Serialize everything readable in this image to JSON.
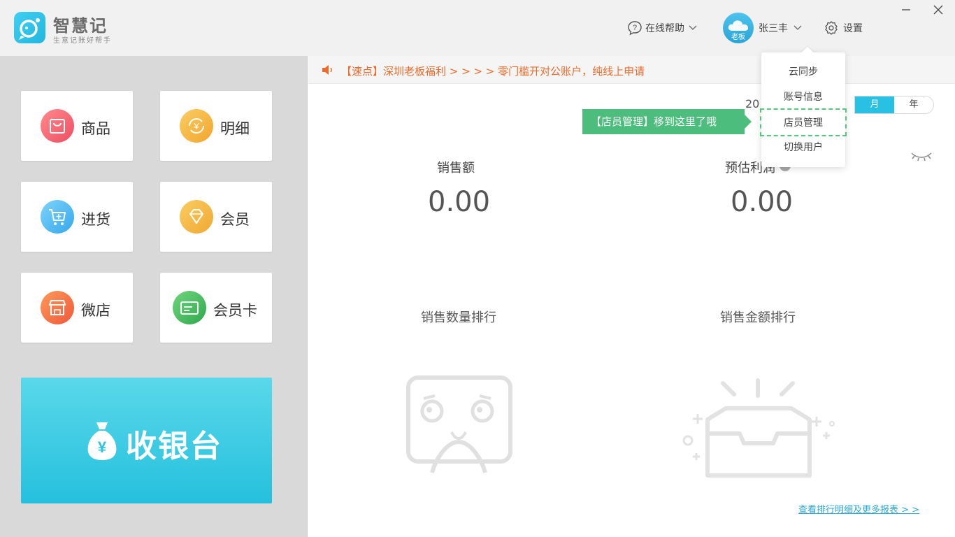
{
  "app": {
    "name": "智慧记",
    "slogan": "生意记账好帮手"
  },
  "header": {
    "help_label": "在线帮助",
    "user": {
      "role": "老板",
      "name": "张三丰"
    },
    "settings_label": "设置"
  },
  "sidebar": {
    "tiles": [
      {
        "label": "商品",
        "icon": "product-bag-icon",
        "color": "#f25f6e"
      },
      {
        "label": "明细",
        "icon": "yuan-cycle-icon",
        "color": "#f5b13a"
      },
      {
        "label": "进货",
        "icon": "cart-icon",
        "color": "#3fb3ef"
      },
      {
        "label": "会员",
        "icon": "diamond-icon",
        "color": "#f2b53a"
      },
      {
        "label": "微店",
        "icon": "shop-icon",
        "color": "#f46a3a"
      },
      {
        "label": "会员卡",
        "icon": "card-icon",
        "color": "#3aba5a"
      }
    ],
    "cashier_label": "收银台"
  },
  "notice": {
    "text": "【速点】深圳老板福利 > > > >  零门槛开对公账户，纯线上申请"
  },
  "period": {
    "year_partial": "20",
    "tabs": [
      "月",
      "年"
    ],
    "active": "月"
  },
  "stats": [
    {
      "label": "销售额",
      "value": "0.00"
    },
    {
      "label": "预估利润",
      "value": "0.00"
    }
  ],
  "rankings": {
    "qty_title": "销售数量排行",
    "amount_title": "销售金额排行"
  },
  "more_link": "查看排行明细及更多报表 > >",
  "dropdown": {
    "items": [
      "云同步",
      "账号信息",
      "店员管理",
      "切换用户"
    ],
    "highlighted": "店员管理"
  },
  "tooltip": "【店员管理】移到这里了哦"
}
